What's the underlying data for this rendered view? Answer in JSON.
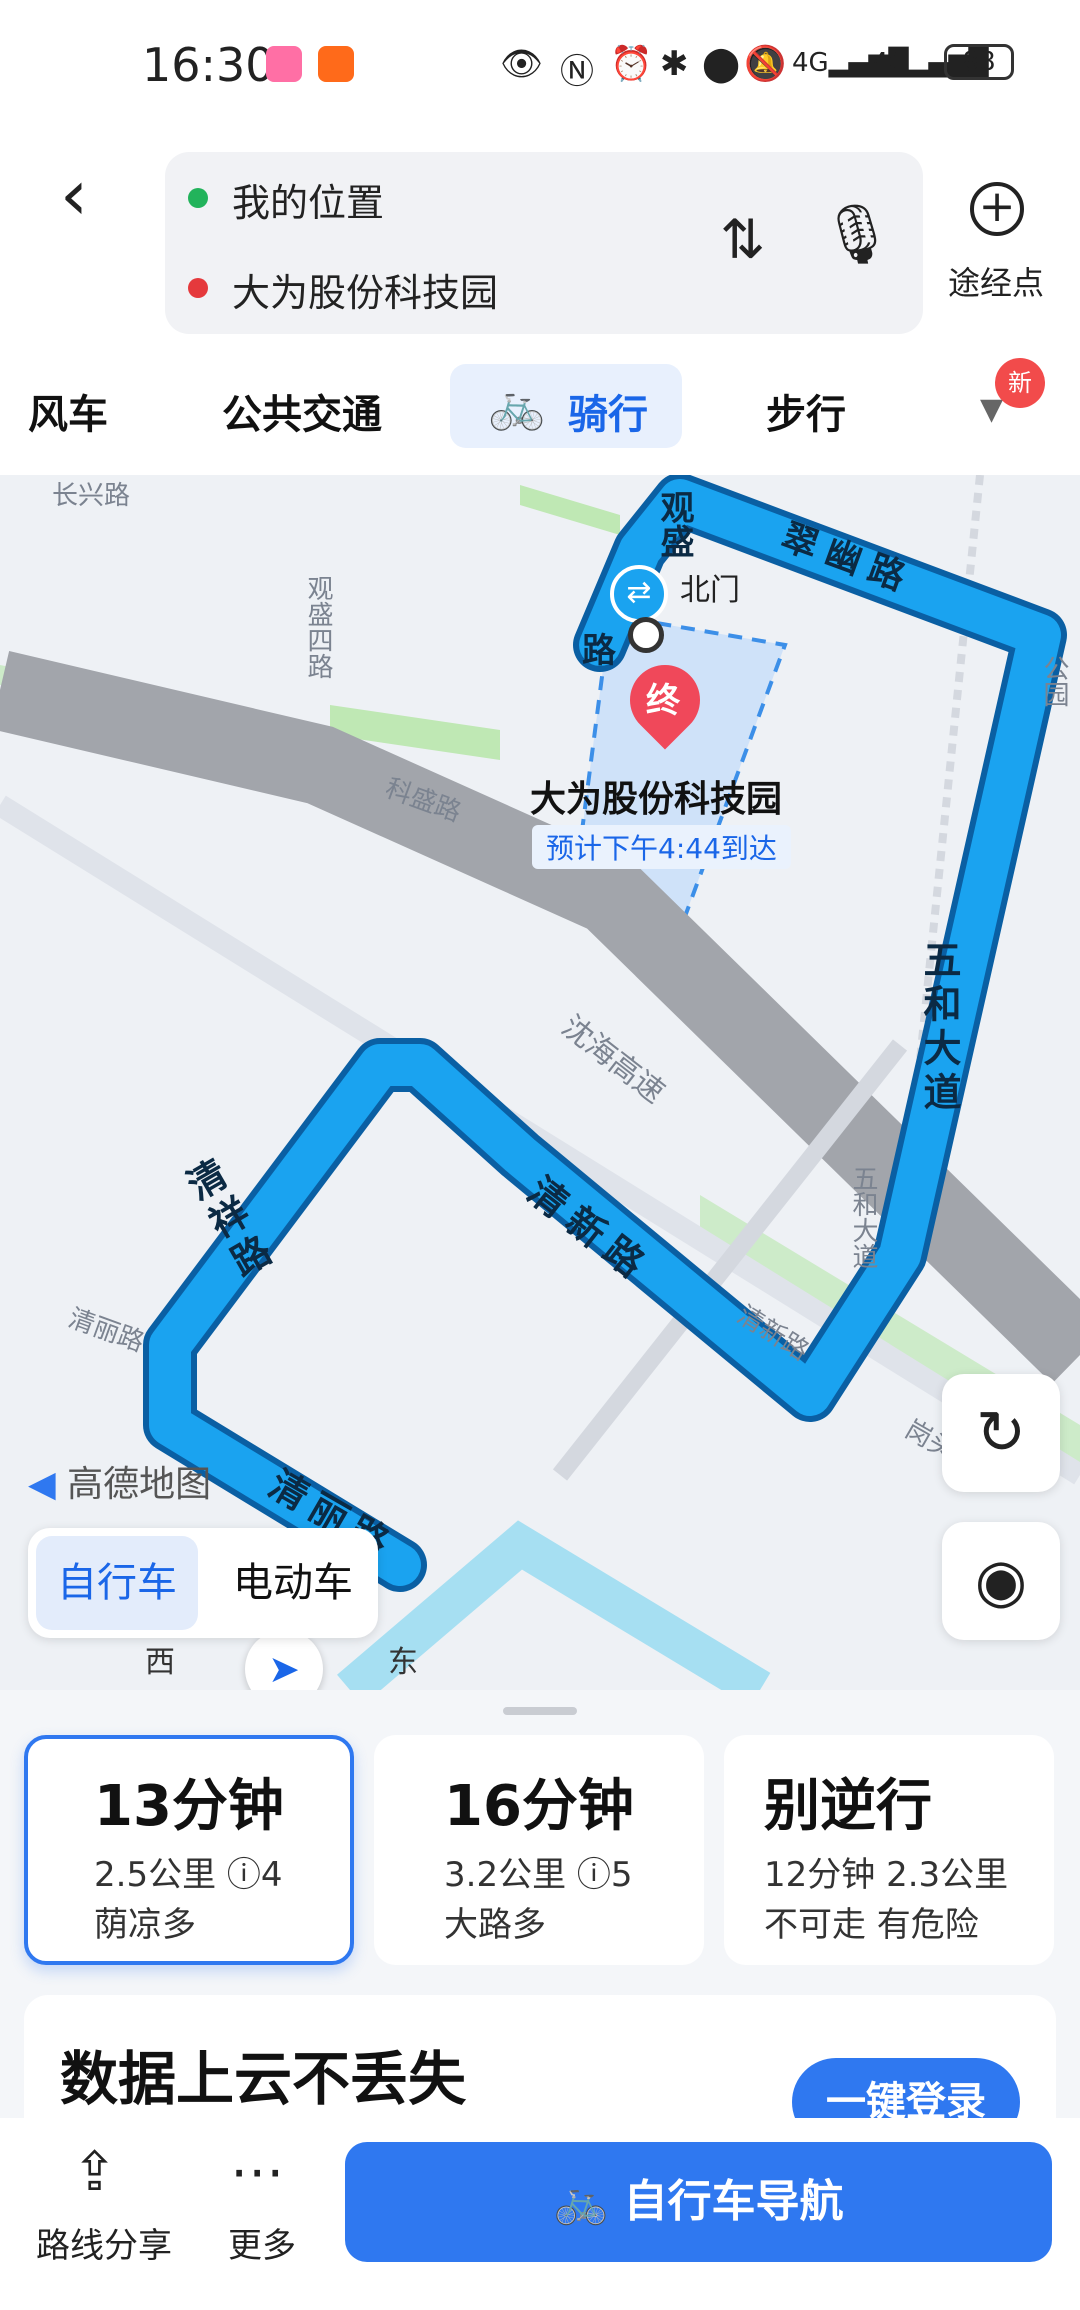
{
  "status_bar": {
    "time": "16:30",
    "battery": "88",
    "icons": [
      "bilibili-icon",
      "app-icon",
      "eye-icon",
      "nfc-icon",
      "alarm-icon",
      "bluetooth-icon",
      "location-icon",
      "mute-icon",
      "signal-4g-icon",
      "signal-4g-icon"
    ]
  },
  "header": {
    "back_icon": "‹",
    "origin": "我的位置",
    "destination": "大为股份科技园",
    "waypoint_label": "途经点",
    "colors": {
      "origin_dot": "#22b35b",
      "destination_dot": "#e5393c"
    }
  },
  "tabs": [
    {
      "label": "风车"
    },
    {
      "label": "公共交通"
    },
    {
      "label": "骑行",
      "selected": true
    },
    {
      "label": "步行"
    }
  ],
  "new_badge": "新",
  "map": {
    "roads": {
      "changxing": "长兴路",
      "guansheng_r": "观盛四路",
      "kesheng": "科盛路",
      "shenhai": "沈海高速",
      "qingli_l": "清丽路",
      "qingxin_small": "清新路",
      "wuhe_small": "五和大道",
      "gongyuan": "公园",
      "gangxia": "岗头"
    },
    "route_labels": {
      "guansheng": "观盛",
      "lu": "路",
      "cuiyou": "翠幽路",
      "wuhe": "五和大道",
      "qingxin": "清新路",
      "qingxiang": "清祥路",
      "qingli": "清丽路"
    },
    "poi_gate": "北门",
    "destination_marker": "终",
    "destination_name": "大为股份科技园",
    "eta": "预计下午4:44到达",
    "compass_w": "西",
    "compass_e": "东",
    "logo": "高德地图",
    "colors": {
      "route": "#1aa3f0",
      "route_border": "#0a5fa3"
    }
  },
  "vehicle_type": {
    "bike": "自行车",
    "ebike": "电动车"
  },
  "route_options": [
    {
      "time": "13分钟",
      "detail": "2.5公里  ⓘ4",
      "tag": "荫凉多",
      "selected": true
    },
    {
      "time": "16分钟",
      "detail": "3.2公里  ⓘ5",
      "tag": "大路多"
    },
    {
      "time": "别逆行",
      "detail": "12分钟 2.3公里",
      "tag": "不可走 有危险"
    }
  ],
  "promo": {
    "title": "数据上云不丢失",
    "button": "一键登录"
  },
  "bottom_bar": {
    "share_label": "路线分享",
    "more_label": "更多",
    "nav_label": "自行车导航"
  }
}
